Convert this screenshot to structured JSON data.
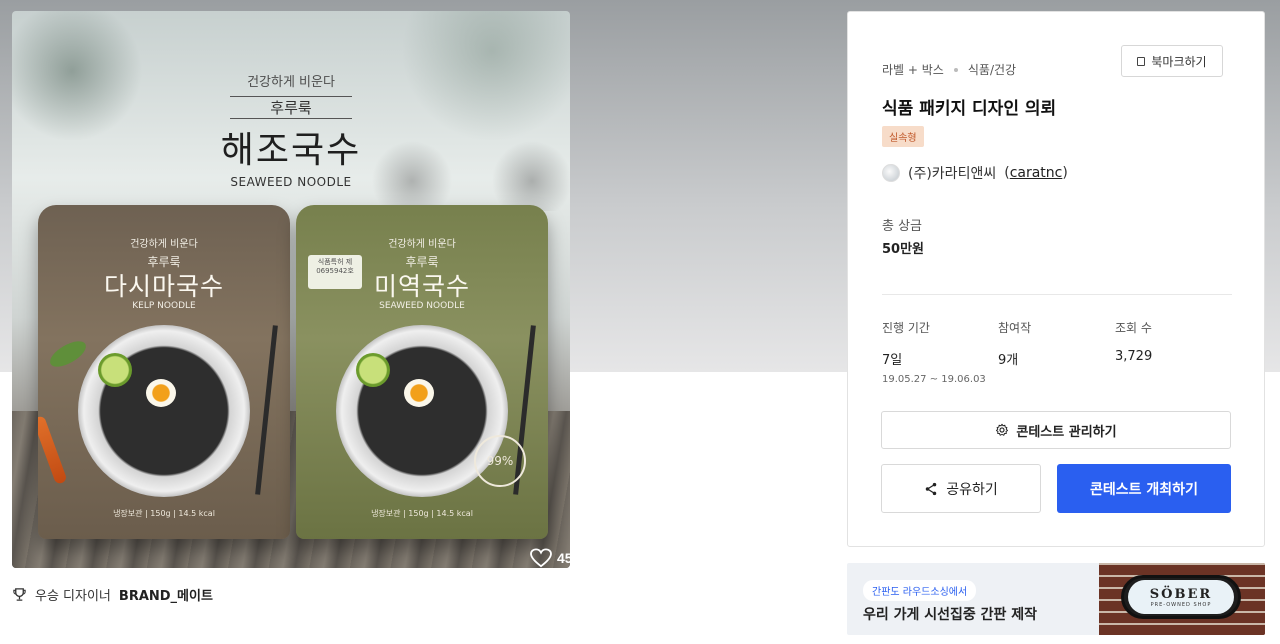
{
  "hero": {
    "brand_tagline": "건강하게 비운다",
    "brand_sub": "후루룩",
    "brand_main": "해조국수",
    "brand_en": "SEAWEED NOODLE",
    "pouch_left": {
      "tag": "건강하게 비운다",
      "sub": "후루룩",
      "main": "다시마국수",
      "en": "KELP NOODLE",
      "info": "냉장보관 | 150g | 14.5 kcal"
    },
    "pouch_right": {
      "tag": "건강하게 비운다",
      "sub": "후루룩",
      "main": "미역국수",
      "en": "SEAWEED NOODLE",
      "stamp": "식품특허 제 0695942호",
      "seal": "99%",
      "info": "냉장보관 | 150g | 14.5 kcal"
    },
    "like_count": "45"
  },
  "winner": {
    "label": "우승 디자이너",
    "name": "BRAND_메이트"
  },
  "card": {
    "breadcrumbs": [
      "라벨 + 박스",
      "식품/건강"
    ],
    "bookmark_label": "북마크하기",
    "title": "식품 패키지 디자인 의뢰",
    "badge": "실속형",
    "host_name": "(주)카라티앤씨",
    "host_handle": "caratnc",
    "prize_label": "총 상금",
    "prize_value": "50만원",
    "stats": {
      "period_label": "진행 기간",
      "period_value": "7일",
      "period_range": "19.05.27 ~ 19.06.03",
      "entries_label": "참여작",
      "entries_value": "9개",
      "views_label": "조회 수",
      "views_value": "3,729"
    },
    "manage_label": "콘테스트 관리하기",
    "share_label": "공유하기",
    "host_contest_label": "콘테스트 개최하기",
    "accent_color": "#2a5ff0"
  },
  "ad": {
    "pill": "간판도 라우드소싱에서",
    "headline": "우리 가게 시선집중 간판 제작",
    "sign_big": "SÖBER",
    "sign_small": "PRE-OWNED SHOP"
  }
}
